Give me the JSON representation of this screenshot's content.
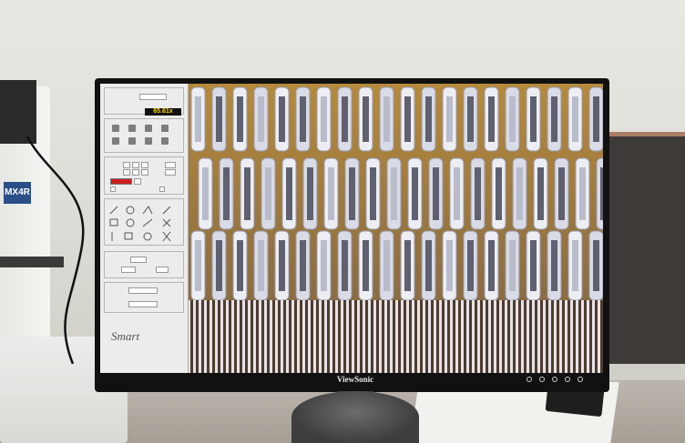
{
  "monitor": {
    "brand": "ViewSonic"
  },
  "microscope": {
    "model_label": "MX4R"
  },
  "software": {
    "magnification": "65.61x",
    "product_name": "Smart",
    "panel_sections": [
      "",
      "",
      "",
      "",
      "",
      ""
    ]
  },
  "colors": {
    "screen_bezel": "#111111",
    "panel_bg": "#ececec",
    "magnification_readout_text": "#ffd700",
    "magnification_readout_bg": "#111111",
    "scope_logo_blue": "#2a4f88",
    "color_swatch": "#cc1f1f"
  },
  "icons": [
    "pause-icon",
    "camera-icon",
    "record-icon",
    "settings-icon",
    "folder-icon",
    "line-tool-icon",
    "circle-tool-icon",
    "angle-tool-icon",
    "rectangle-tool-icon",
    "delete-icon"
  ]
}
